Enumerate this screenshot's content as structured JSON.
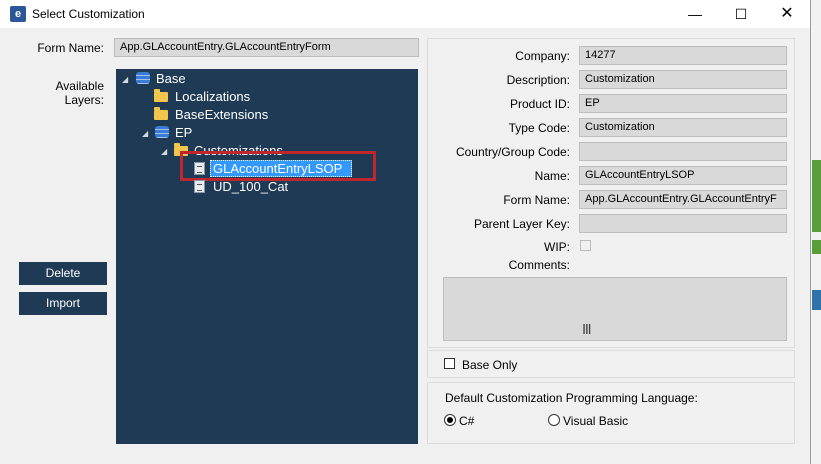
{
  "window": {
    "title": "Select Customization",
    "app_icon": "epicor-e-icon",
    "controls": [
      "minimize-icon",
      "maximize-icon",
      "close-icon"
    ]
  },
  "form": {
    "form_name_label": "Form Name:",
    "form_name_value": "App.GLAccountEntry.GLAccountEntryForm",
    "available_layers_label_line1": "Available",
    "available_layers_label_line2": "Layers:"
  },
  "tree": {
    "base": "Base",
    "localizations": "Localizations",
    "base_extensions": "BaseExtensions",
    "ep": "EP",
    "customizations": "Customizations",
    "selected_item": "GLAccountEntryLSOP",
    "other_item": "UD_100_Cat"
  },
  "buttons": {
    "delete": "Delete",
    "import": "Import"
  },
  "details": {
    "company_label": "Company:",
    "company_value": "14277",
    "description_label": "Description:",
    "description_value": "Customization",
    "product_label": "Product ID:",
    "product_value": "EP",
    "type_label": "Type Code:",
    "type_value": "Customization",
    "country_label": "Country/Group Code:",
    "country_value": "",
    "name_label": "Name:",
    "name_value": "GLAccountEntryLSOP",
    "formname_label": "Form Name:",
    "formname_value": "App.GLAccountEntry.GLAccountEntryF",
    "parent_label": "Parent Layer Key:",
    "parent_value": "",
    "wip_label": "WIP:",
    "comments_label": "Comments:",
    "comments_value": ""
  },
  "base_only": {
    "label": "Base Only",
    "checked": false
  },
  "language": {
    "title": "Default Customization Programming Language:",
    "csharp": "C#",
    "vb": "Visual Basic",
    "selected": "C#"
  },
  "colors": {
    "tree_bg": "#1f3a55",
    "highlight": "#c0262d",
    "selected_bg": "#3399ff"
  }
}
